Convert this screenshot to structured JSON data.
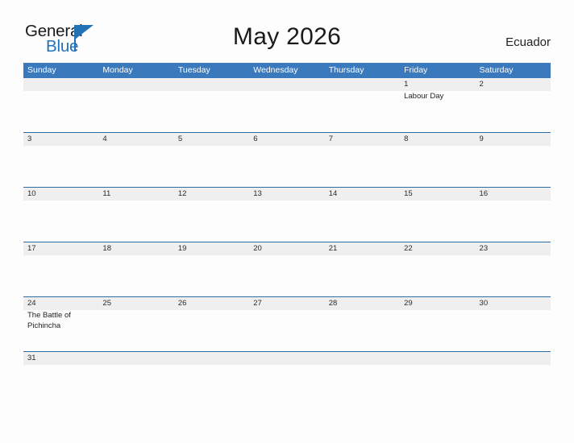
{
  "brand": {
    "name_part1": "General",
    "name_part2": "Blue"
  },
  "header": {
    "title": "May 2026",
    "country": "Ecuador"
  },
  "colors": {
    "header_blue": "#3a79bc",
    "row_separator": "#2e6ca6",
    "day_band_gray": "#efefef",
    "brand_blue": "#2272b8",
    "page_background": "#fdfdfd",
    "text": "#222222"
  },
  "calendar": {
    "month": "May",
    "year": "2026",
    "day_names": [
      "Sunday",
      "Monday",
      "Tuesday",
      "Wednesday",
      "Thursday",
      "Friday",
      "Saturday"
    ],
    "weeks": [
      {
        "days": [
          {
            "number": "",
            "event": ""
          },
          {
            "number": "",
            "event": ""
          },
          {
            "number": "",
            "event": ""
          },
          {
            "number": "",
            "event": ""
          },
          {
            "number": "",
            "event": ""
          },
          {
            "number": "1",
            "event": "Labour Day"
          },
          {
            "number": "2",
            "event": ""
          }
        ]
      },
      {
        "days": [
          {
            "number": "3",
            "event": ""
          },
          {
            "number": "4",
            "event": ""
          },
          {
            "number": "5",
            "event": ""
          },
          {
            "number": "6",
            "event": ""
          },
          {
            "number": "7",
            "event": ""
          },
          {
            "number": "8",
            "event": ""
          },
          {
            "number": "9",
            "event": ""
          }
        ]
      },
      {
        "days": [
          {
            "number": "10",
            "event": ""
          },
          {
            "number": "11",
            "event": ""
          },
          {
            "number": "12",
            "event": ""
          },
          {
            "number": "13",
            "event": ""
          },
          {
            "number": "14",
            "event": ""
          },
          {
            "number": "15",
            "event": ""
          },
          {
            "number": "16",
            "event": ""
          }
        ]
      },
      {
        "days": [
          {
            "number": "17",
            "event": ""
          },
          {
            "number": "18",
            "event": ""
          },
          {
            "number": "19",
            "event": ""
          },
          {
            "number": "20",
            "event": ""
          },
          {
            "number": "21",
            "event": ""
          },
          {
            "number": "22",
            "event": ""
          },
          {
            "number": "23",
            "event": ""
          }
        ]
      },
      {
        "days": [
          {
            "number": "24",
            "event": "The Battle of Pichincha"
          },
          {
            "number": "25",
            "event": ""
          },
          {
            "number": "26",
            "event": ""
          },
          {
            "number": "27",
            "event": ""
          },
          {
            "number": "28",
            "event": ""
          },
          {
            "number": "29",
            "event": ""
          },
          {
            "number": "30",
            "event": ""
          }
        ]
      },
      {
        "days": [
          {
            "number": "31",
            "event": ""
          },
          {
            "number": "",
            "event": ""
          },
          {
            "number": "",
            "event": ""
          },
          {
            "number": "",
            "event": ""
          },
          {
            "number": "",
            "event": ""
          },
          {
            "number": "",
            "event": ""
          },
          {
            "number": "",
            "event": ""
          }
        ]
      }
    ]
  }
}
